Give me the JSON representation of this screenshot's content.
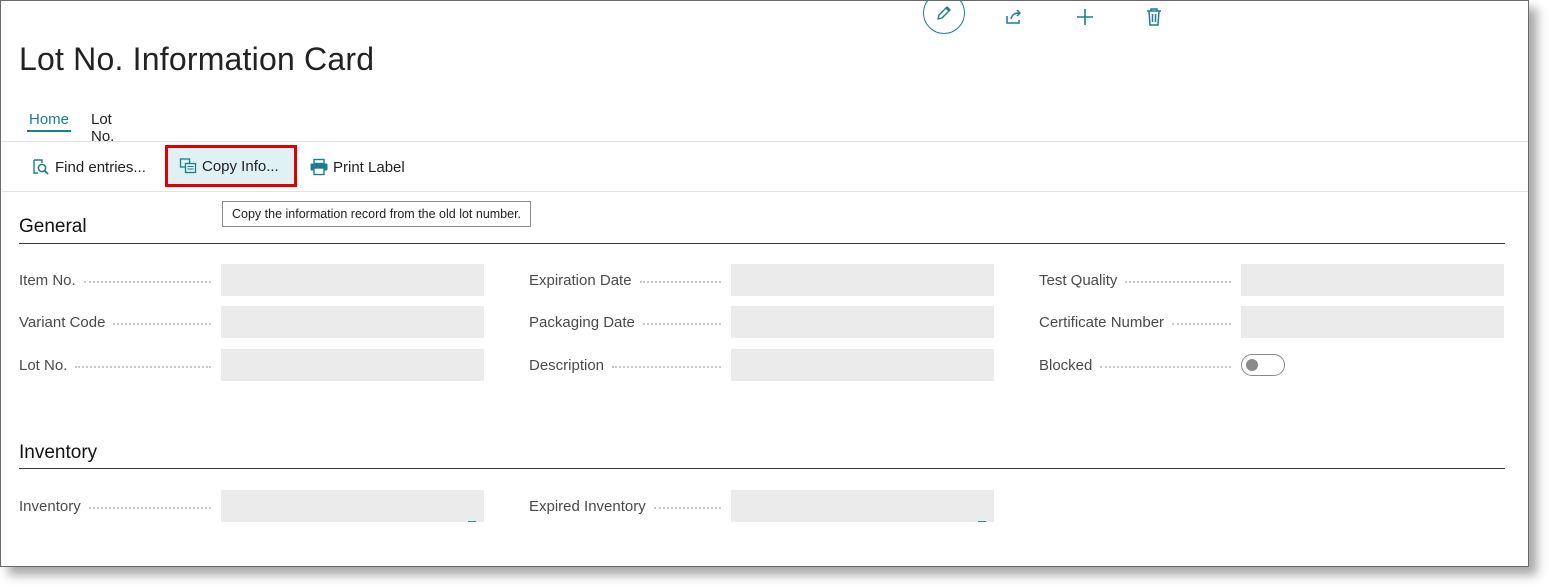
{
  "page": {
    "title": "Lot No. Information Card"
  },
  "header_actions": [
    {
      "name": "edit",
      "icon": "pencil-icon"
    },
    {
      "name": "share",
      "icon": "share-icon"
    },
    {
      "name": "new",
      "icon": "plus-icon"
    },
    {
      "name": "delete",
      "icon": "trash-icon"
    }
  ],
  "tabs": {
    "home": "Home",
    "lot_no": "Lot No."
  },
  "actions": {
    "find_entries": "Find entries...",
    "copy_info": "Copy Info...",
    "print_label": "Print Label"
  },
  "tooltip": "Copy the information record from the old lot number.",
  "general": {
    "title": "General",
    "fields": {
      "item_no": {
        "label": "Item No.",
        "value": ""
      },
      "variant_code": {
        "label": "Variant Code",
        "value": ""
      },
      "lot_no": {
        "label": "Lot No.",
        "value": ""
      },
      "expiration_date": {
        "label": "Expiration Date",
        "value": ""
      },
      "packaging_date": {
        "label": "Packaging Date",
        "value": ""
      },
      "description": {
        "label": "Description",
        "value": ""
      },
      "test_quality": {
        "label": "Test Quality",
        "value": ""
      },
      "certificate_number": {
        "label": "Certificate Number",
        "value": ""
      },
      "blocked": {
        "label": "Blocked",
        "value": false
      }
    }
  },
  "inventory": {
    "title": "Inventory",
    "fields": {
      "inventory": {
        "label": "Inventory",
        "value": "_"
      },
      "expired_inventory": {
        "label": "Expired Inventory",
        "value": "_"
      }
    }
  },
  "colors": {
    "accent": "#1b7f8a",
    "highlight_border": "#e00000",
    "field_bg": "#ebebeb"
  }
}
